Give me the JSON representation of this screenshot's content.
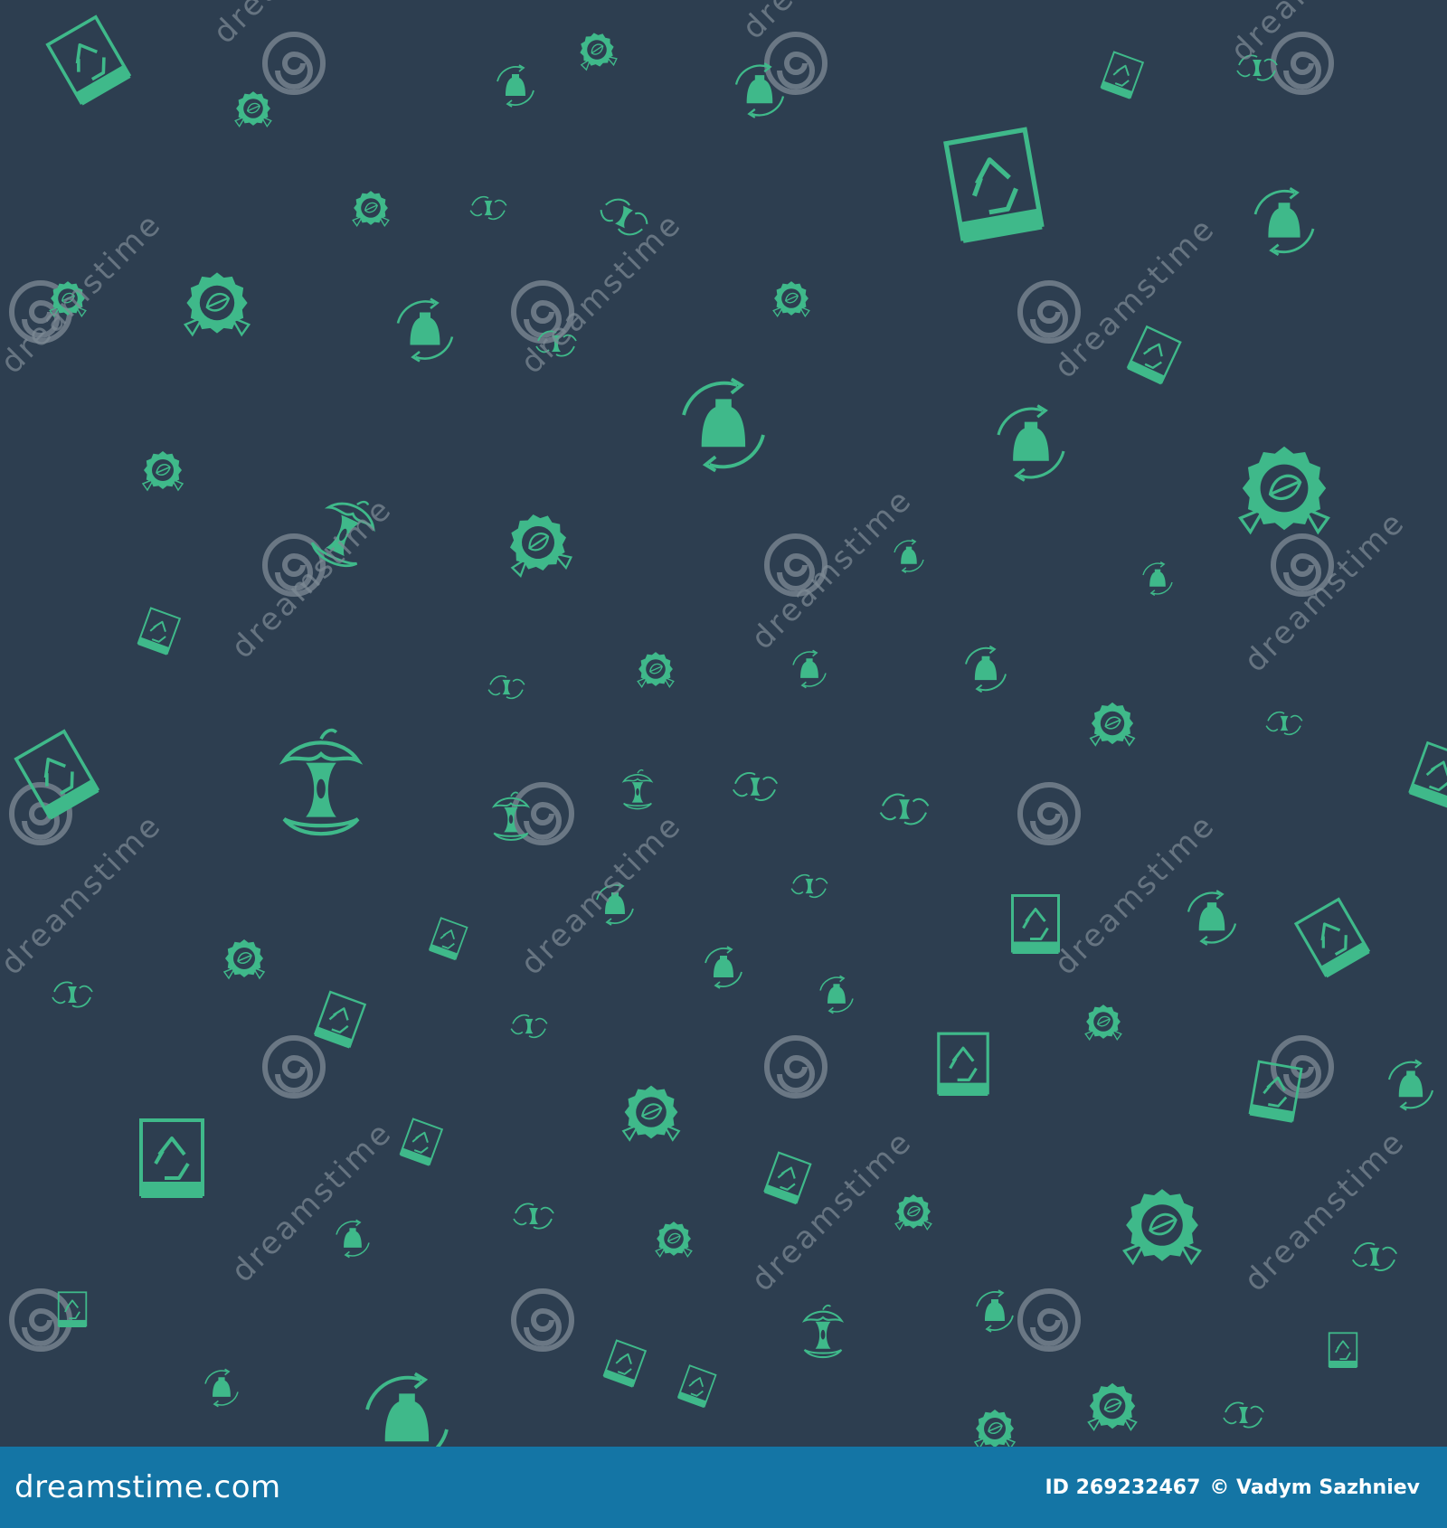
{
  "colors": {
    "background": "#2d3e50",
    "icon": "#3fb98a",
    "watermark": "#7f8b96",
    "footer": "#1475a5"
  },
  "pattern": {
    "icon_names": [
      "recycle-bin-icon",
      "eco-leaf-badge-icon",
      "recycle-bottle-icon",
      "apple-core-icon",
      "hands-apple-core-icon"
    ]
  },
  "watermark": {
    "text": "dreamstime"
  },
  "footer": {
    "brand": "dreamstime.com",
    "id_label": "ID 269232467",
    "author": "© Vadym Sazhniev"
  }
}
